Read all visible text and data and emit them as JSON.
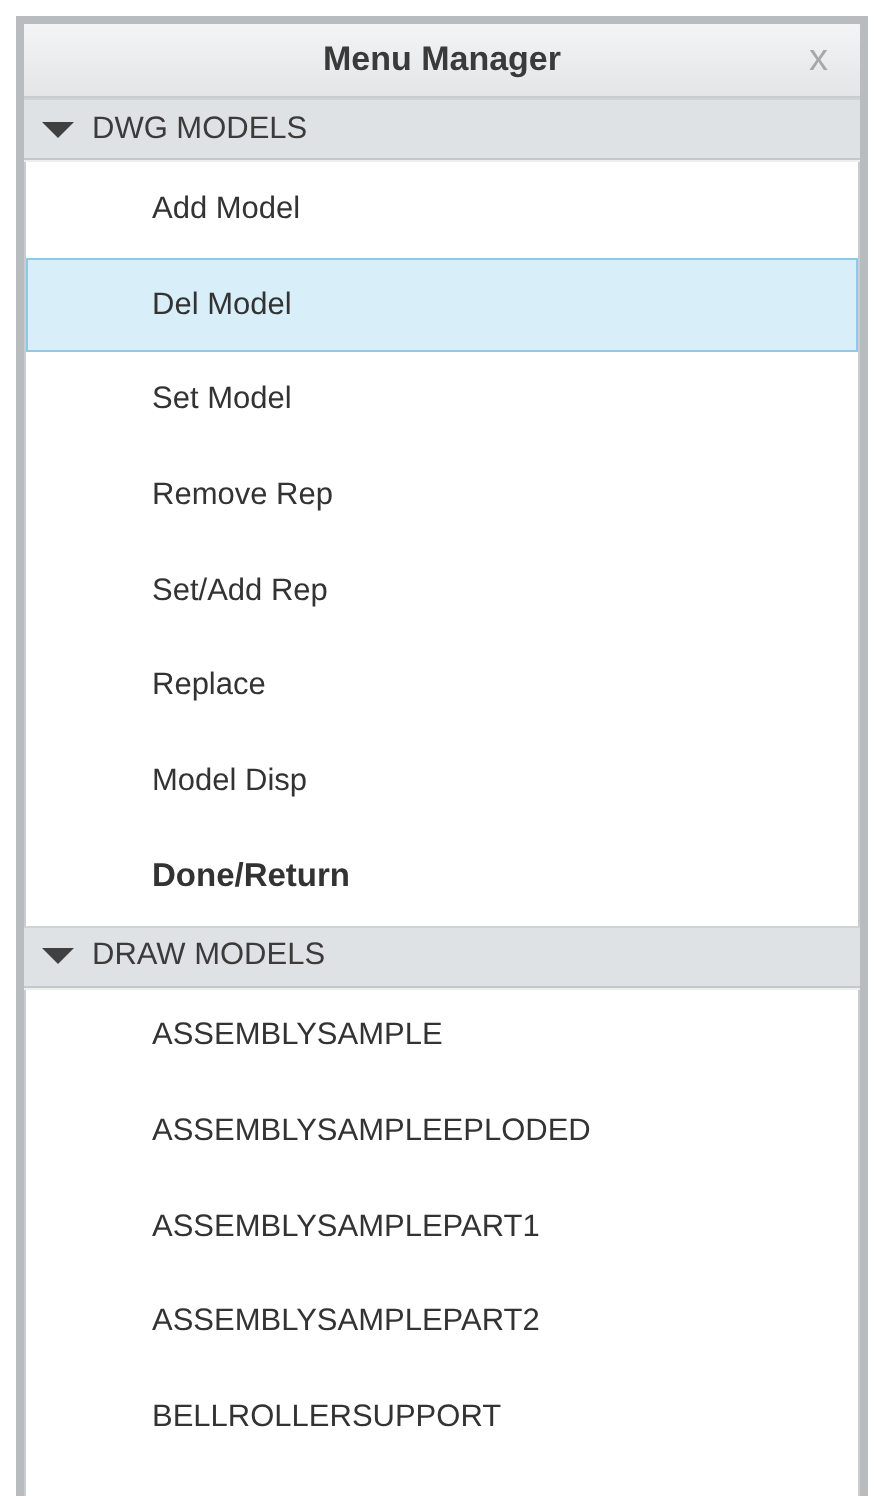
{
  "window": {
    "title": "Menu Manager",
    "close": "x"
  },
  "sections": [
    {
      "title": "DWG MODELS",
      "expanded": true,
      "items": [
        {
          "label": "Add Model",
          "kind": "command",
          "selected": false
        },
        {
          "label": "Del Model",
          "kind": "command",
          "selected": true
        },
        {
          "label": "Set Model",
          "kind": "command",
          "selected": false
        },
        {
          "label": "Remove Rep",
          "kind": "command",
          "selected": false
        },
        {
          "label": "Set/Add Rep",
          "kind": "command",
          "selected": false
        },
        {
          "label": "Replace",
          "kind": "command",
          "selected": false
        },
        {
          "label": "Model Disp",
          "kind": "command",
          "selected": false
        },
        {
          "label": "Done/Return",
          "kind": "exit",
          "selected": false
        }
      ]
    },
    {
      "title": "DRAW MODELS",
      "expanded": true,
      "items": [
        {
          "label": "ASSEMBLYSAMPLE",
          "kind": "command",
          "selected": false
        },
        {
          "label": "ASSEMBLYSAMPLEEPLODED",
          "kind": "command",
          "selected": false
        },
        {
          "label": "ASSEMBLYSAMPLEPART1",
          "kind": "command",
          "selected": false
        },
        {
          "label": "ASSEMBLYSAMPLEPART2",
          "kind": "command",
          "selected": false
        },
        {
          "label": "BELLROLLERSUPPORT",
          "kind": "command",
          "selected": false
        }
      ]
    }
  ]
}
